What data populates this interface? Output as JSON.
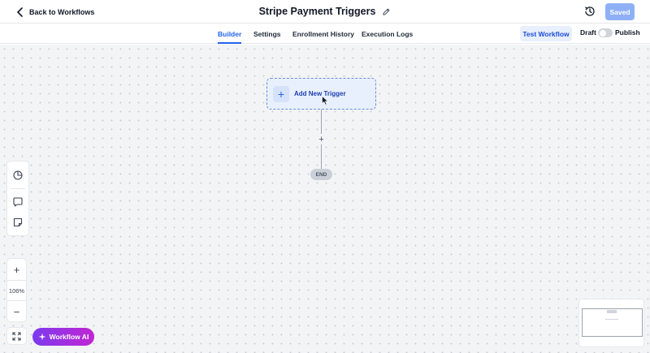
{
  "header": {
    "back_label": "Back to Workflows",
    "title": "Stripe Payment Triggers",
    "saved_label": "Saved"
  },
  "tabs": [
    {
      "label": "Builder",
      "active": true
    },
    {
      "label": "Settings",
      "active": false
    },
    {
      "label": "Enrollment History",
      "active": false
    },
    {
      "label": "Execution Logs",
      "active": false
    }
  ],
  "actions": {
    "test_label": "Test Workflow",
    "draft_label": "Draft",
    "publish_label": "Publish",
    "published": false
  },
  "canvas": {
    "trigger_label": "Add New Trigger",
    "add_step_glyph": "+",
    "end_label": "END"
  },
  "zoom": {
    "in_glyph": "+",
    "level": "106%",
    "out_glyph": "−"
  },
  "ai": {
    "label": "Workflow AI"
  },
  "colors": {
    "accent": "#2563eb",
    "saved_button": "#8fb0f7",
    "ai_gradient_start": "#7c3aed",
    "ai_gradient_end": "#c026d3"
  },
  "icons": [
    "chevron-left-icon",
    "pencil-icon",
    "history-icon",
    "pie-chart-icon",
    "comment-icon",
    "sticky-note-icon",
    "expand-icon",
    "sparkles-icon",
    "plus-icon"
  ]
}
